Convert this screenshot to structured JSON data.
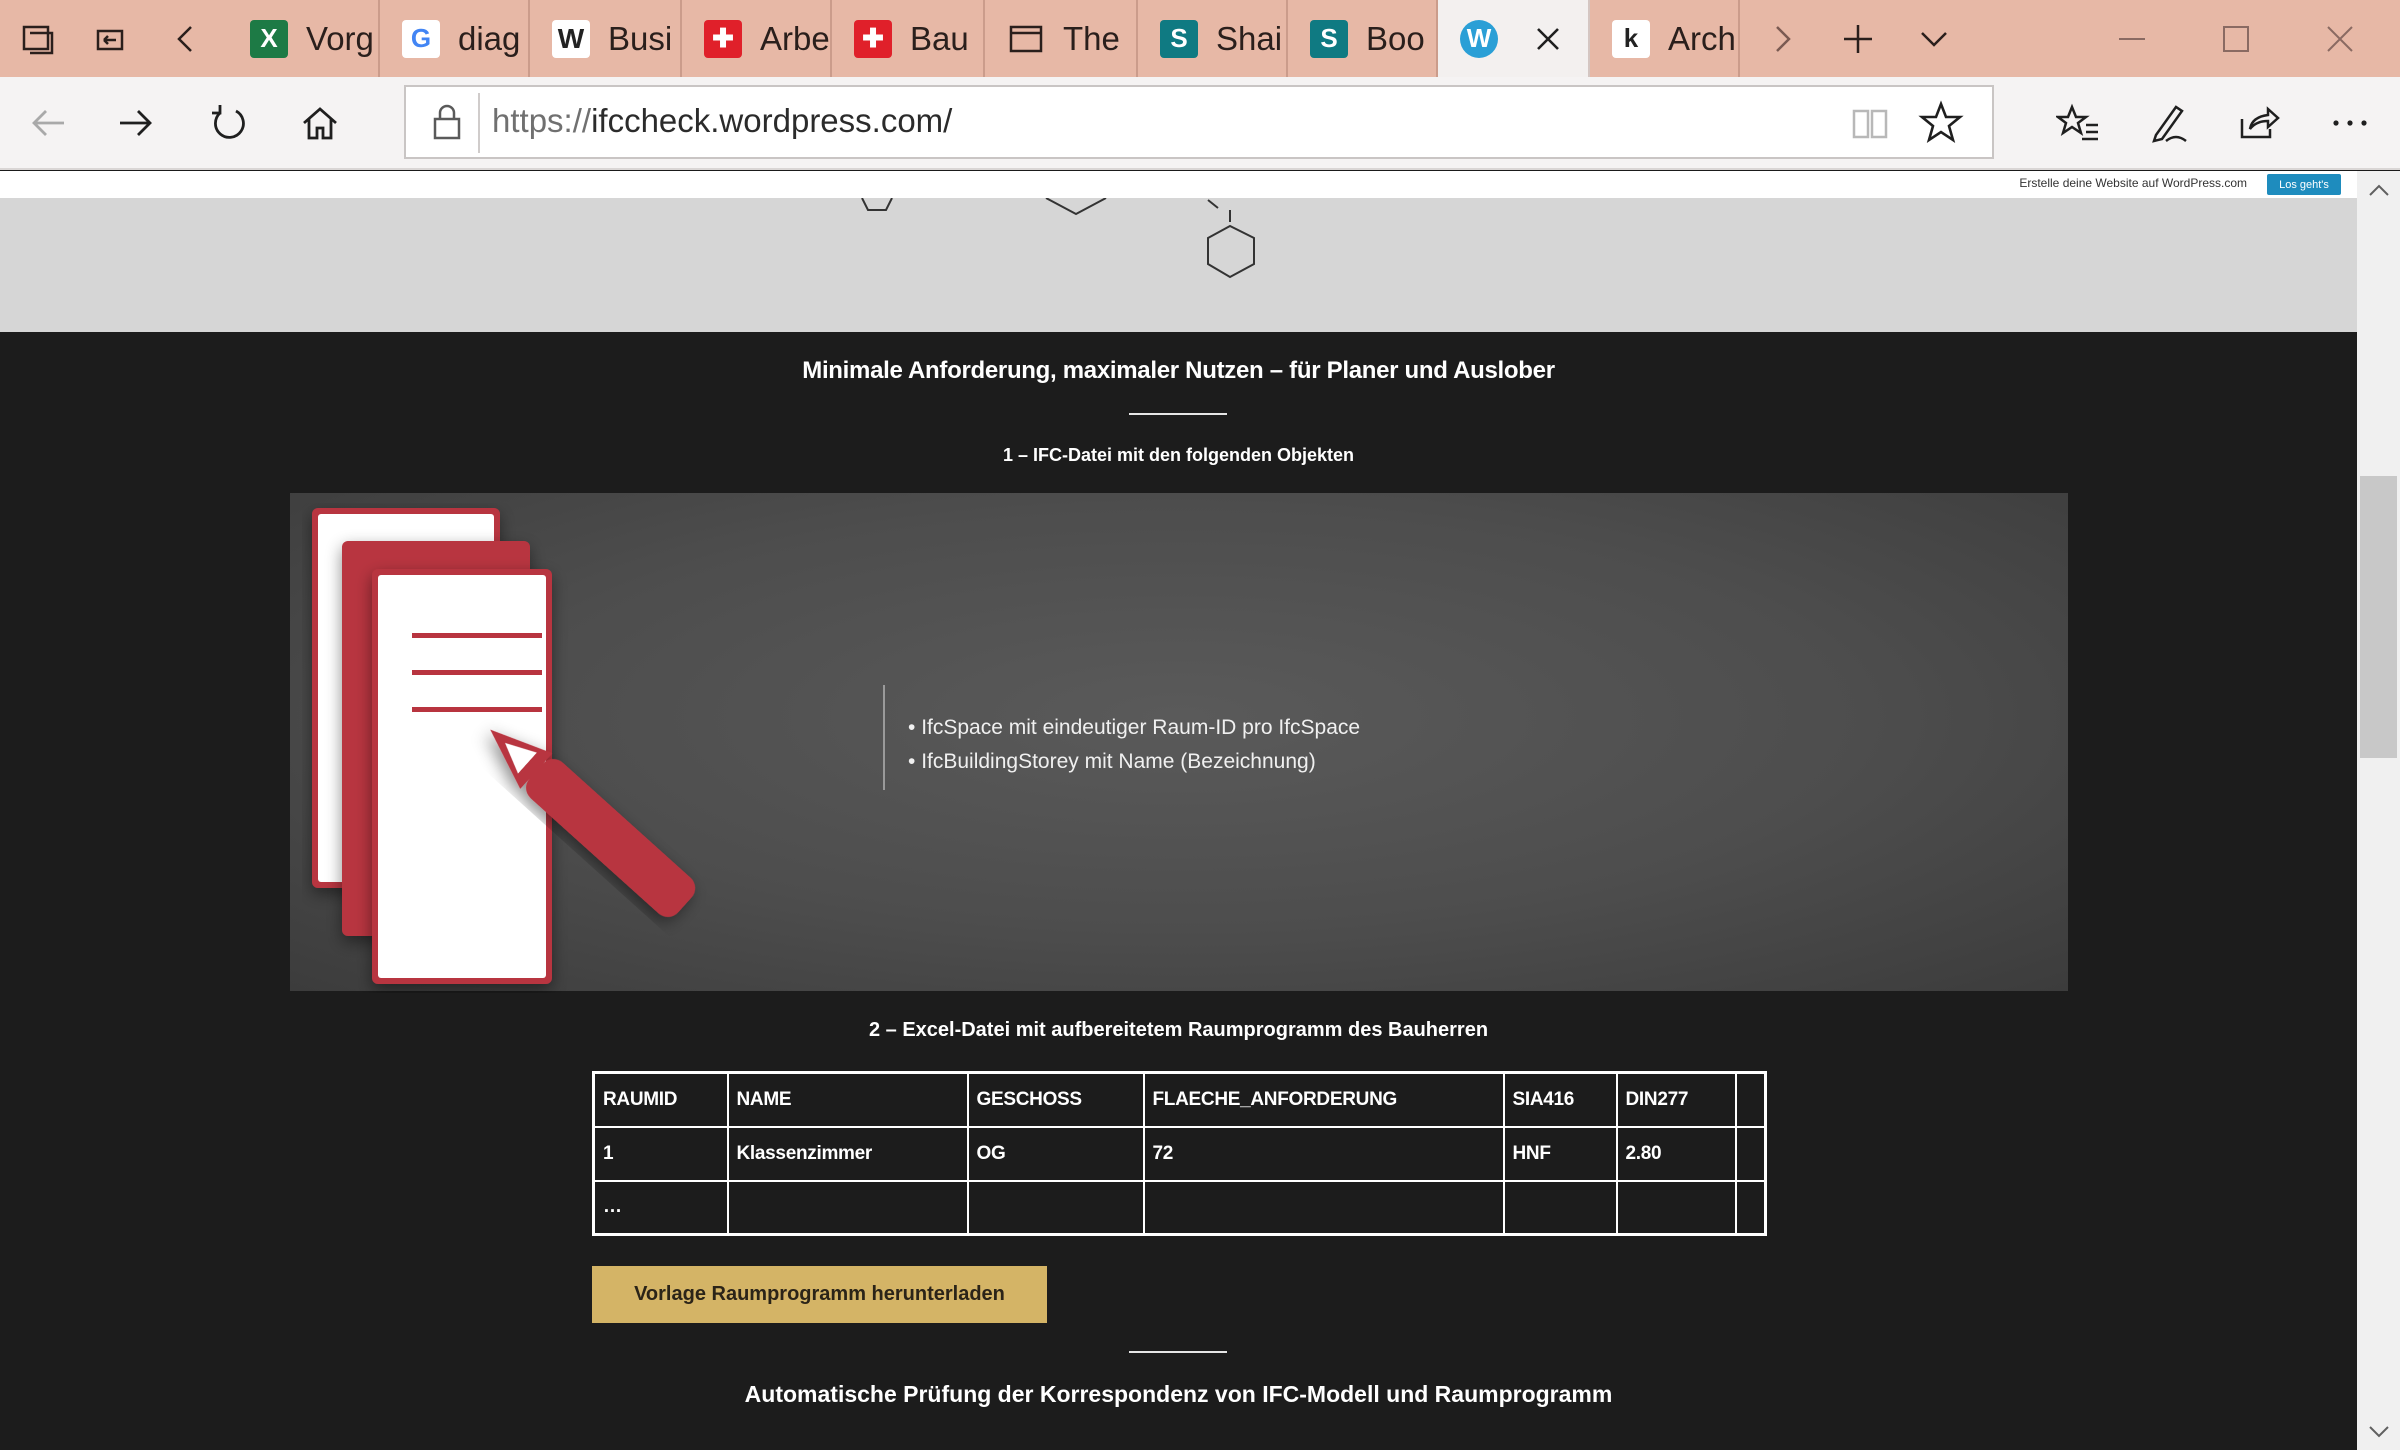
{
  "browser": {
    "tabs": [
      {
        "title": "Vorg",
        "favicon": "excel-icon",
        "fav_bg": "#1d7a45",
        "fav_text": "X"
      },
      {
        "title": "diag",
        "favicon": "google-icon",
        "fav_bg": "#ffffff",
        "fav_text": "G"
      },
      {
        "title": "Busi",
        "favicon": "wikipedia-icon",
        "fav_bg": "#ffffff",
        "fav_text": "W"
      },
      {
        "title": "Arbe",
        "favicon": "swiss-flag-icon",
        "fav_bg": "#e0202a",
        "fav_text": "✚"
      },
      {
        "title": "Bau",
        "favicon": "swiss-flag-icon",
        "fav_bg": "#e0202a",
        "fav_text": "✚"
      },
      {
        "title": "The",
        "favicon": "window-icon",
        "fav_bg": "none",
        "fav_text": ""
      },
      {
        "title": "Shai",
        "favicon": "sharepoint-icon",
        "fav_bg": "#0f7a82",
        "fav_text": "S"
      },
      {
        "title": "Boo",
        "favicon": "sharepoint-icon",
        "fav_bg": "#0f7a82",
        "fav_text": "S"
      },
      {
        "title": "",
        "favicon": "wordpress-icon",
        "fav_bg": "#2a9fd6",
        "fav_text": "W",
        "active": true
      },
      {
        "title": "Arch",
        "favicon": "k-icon",
        "fav_bg": "#ffffff",
        "fav_text": "k"
      }
    ],
    "url": {
      "protocol": "https://",
      "host": "ifccheck.wordpress.com/"
    }
  },
  "wp_bar": {
    "text": "Erstelle deine Website auf WordPress.com",
    "button": "Los geht's"
  },
  "section": {
    "title": "Minimale Anforderung, maximaler Nutzen – für Planer und Auslober",
    "step1_title": "1 – IFC-Datei mit den folgenden Objekten",
    "ifc_items": [
      "IfcSpace mit eindeutiger Raum-ID pro IfcSpace",
      "IfcBuildingStorey mit Name (Bezeichnung)"
    ],
    "step2_title": "2 – Excel-Datei mit aufbereitetem Raumprogramm des Bauherren",
    "table": {
      "headers": [
        "RAUMID",
        "NAME",
        "GESCHOSS",
        "FLAECHE_ANFORDERUNG",
        "SIA416",
        "DIN277",
        ""
      ],
      "rows": [
        [
          "1",
          "Klassenzimmer",
          "OG",
          "72",
          "HNF",
          "2.80",
          ""
        ],
        [
          "…",
          "",
          "",
          "",
          "",
          "",
          ""
        ]
      ]
    },
    "download_button": "Vorlage Raumprogramm herunterladen",
    "section2_title": "Automatische Prüfung der Korrespondenz von IFC-Modell und Raumprogramm"
  },
  "colors": {
    "tab_bar": "#e7b8a6",
    "accent_button": "#d4b466",
    "document_red": "#b8343f",
    "page_bg": "#1c1c1c"
  }
}
